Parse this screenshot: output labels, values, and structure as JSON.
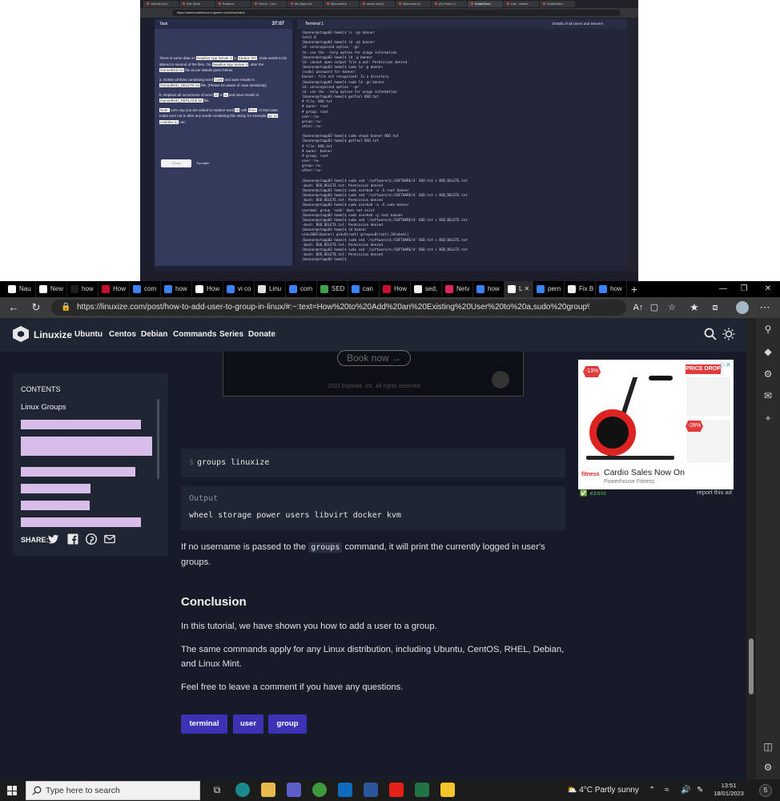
{
  "remote": {
    "tabs": [
      "Ubuntu Linu",
      "Our Work",
      "Examco",
      "Home - Cho",
      "My Apps Da",
      "Microsoft A",
      "azure cloud",
      "Microsoft Co",
      "(2) Feed | Li",
      "KodeKloud",
      "Lab - Author",
      "KodeKloud"
    ],
    "url": "https://www.kodekloud-engineer.com/#/scenario",
    "task_label": "Task",
    "timer": "37:07",
    "task_paragraphs": [
      {
        "parts": [
          {
            "t": "There is some data on "
          },
          {
            "c": "Nautilus App Server 3"
          },
          {
            "t": " in "
          },
          {
            "c": "Stratos"
          },
          {
            "c": "DC"
          },
          {
            "t": ". Data needs to be altered in several of the files. On "
          },
          {
            "c": "Nautilus App Server 3"
          },
          {
            "t": ", alter the "
          },
          {
            "c": "/home/BSD.txt"
          },
          {
            "t": " file as per details given below:"
          }
        ]
      },
      {
        "parts": [
          {
            "t": "a. Delete all lines containing word "
          },
          {
            "c": "code"
          },
          {
            "t": " and save results in "
          },
          {
            "c": "/home/BSD_DELETE.txt"
          },
          {
            "t": " file. (Please be aware of case sensitivity)"
          }
        ]
      },
      {
        "parts": [
          {
            "t": "b. Replace all occurrence of word "
          },
          {
            "c": "or"
          },
          {
            "t": " to "
          },
          {
            "c": "is"
          },
          {
            "t": " and save results in "
          },
          {
            "c": "/home/BSD_REPLACE.txt"
          },
          {
            "t": " file."
          }
        ]
      },
      {
        "parts": [
          {
            "c": "Note:"
          },
          {
            "t": " Let's say you are asked to replace word "
          },
          {
            "c": "to"
          },
          {
            "t": " with "
          },
          {
            "c": "from"
          },
          {
            "t": ". In that case, make sure not to alter any words containing this string; for example "
          },
          {
            "c": "up"
          },
          {
            "c": "to"
          },
          {
            "t": ", "
          },
          {
            "c": "contribu"
          },
          {
            "c": "to"
          },
          {
            "t": "r etc."
          }
        ]
      }
    ],
    "check_label": "Check",
    "try_later_label": "Try Later",
    "terminal_title": "Terminal 1",
    "terminal_right": "Details of all Users and Servers",
    "terminal_lines": [
      "[banner@stapp03 home]$ ls -gn banner",
      "total 0",
      "[banner@stapp03 home]$ ld -gn banner",
      "ld: unrecognized option '-gn'",
      "ld: use the --help option for usage information",
      "[banner@stapp03 home]$ ld -g banner",
      "ld: cannot open output file a.out: Permission denied",
      "[banner@stapp03 home]$ sudo ld -g banner",
      "[sudo] password for banner:",
      "banner: file not recognized: Is a directory",
      "[banner@stapp03 home]$ sudo ld -gn banner",
      "ld: unrecognized option '-gn'",
      "ld: use the --help option for usage information",
      "[banner@stapp03 home]$ getfacl BSD.txt",
      "# file: BSD.txt",
      "# owner: root",
      "# group: root",
      "user::rw-",
      "group::rw-",
      "other::rw-",
      "",
      "[banner@stapp03 home]$ sudo chown banner BSD.txt",
      "[banner@stapp03 home]$ getfacl BSD.txt",
      "# file: BSD.txt",
      "# owner: banner",
      "# group: root",
      "user::rw-",
      "group::rw-",
      "other::rw-",
      "",
      "[banner@stapp03 home]$ sudo sed '/software/d;/SOFTWARE/d' BSD.txt > BSD_DELETE.txt",
      "-bash: BSD_DELETE.txt: Permission denied",
      "[banner@stapp03 home]$ sudo usermod -a -G root banner",
      "[banner@stapp03 home]$ sudo sed '/software/d;/SOFTWARE/d' BSD.txt > BSD_DELETE.txt",
      "-bash: BSD_DELETE.txt: Permission denied",
      "[banner@stapp03 home]$ sudo usermod -a -G sudo banner",
      "usermod: group 'sudo' does not exist",
      "[banner@stapp03 home]$ sudo usermod -g root banner",
      "[banner@stapp03 home]$ sudo sed '/software/d;/SOFTWARE/d' BSD.txt > BSD_DELETE.txt",
      "-bash: BSD_DELETE.txt: Permission denied",
      "[banner@stapp03 home]$ id banner",
      "uid=1002(banner) gid=0(root) groups=0(root),10(wheel)",
      "[banner@stapp03 home]$ sudo sed '/software/d;/SOFTWARE/d' BSD.txt > BSD_DELETE.txt",
      "-bash: BSD_DELETE.txt: Permission denied",
      "[banner@stapp03 home]$ sudo sed '/software/d;/SOFTWARE/d' BSD.txt > BSD_DELETE.txt",
      "-bash: BSD_DELETE.txt: Permission denied",
      "[banner@stapp03 home]$ "
    ]
  },
  "browser": {
    "tabs": [
      {
        "label": "Nau",
        "icon": "#ffffff"
      },
      {
        "label": "New",
        "icon": "#ffffff"
      },
      {
        "label": "how",
        "icon": "#1e1e1e"
      },
      {
        "label": "How",
        "icon": "#c8102e"
      },
      {
        "label": "com",
        "icon": "#3b82f6"
      },
      {
        "label": "how",
        "icon": "#3b82f6"
      },
      {
        "label": "How",
        "icon": "#ffffff"
      },
      {
        "label": "vi co",
        "icon": "#3b82f6"
      },
      {
        "label": "Linu",
        "icon": "#e0e0e0"
      },
      {
        "label": "com",
        "icon": "#3b82f6"
      },
      {
        "label": "SED",
        "icon": "#3fa34d"
      },
      {
        "label": "can",
        "icon": "#3b82f6"
      },
      {
        "label": "How",
        "icon": "#c8102e"
      },
      {
        "label": "sed,",
        "icon": "#f0f0f0"
      },
      {
        "label": "Netv",
        "icon": "#e0245e"
      },
      {
        "label": "how",
        "icon": "#3b82f6"
      },
      {
        "label": "L",
        "icon": "#ffffff"
      },
      {
        "label": "pern",
        "icon": "#3b82f6"
      },
      {
        "label": "Fix B",
        "icon": "#f0f0f0"
      },
      {
        "label": "how",
        "icon": "#3b82f6"
      }
    ],
    "active_tab_index": 16,
    "new_tab": "+",
    "url": "https://linuxize.com/post/how-to-add-user-to-group-in-linux/#:~:text=How%20to%20Add%20an%20Existing%20User%20to%20a,sudo%20group%2C%20you%2..."
  },
  "site": {
    "brand": "Linuxize",
    "nav": [
      "Ubuntu",
      "Centos",
      "Debian",
      "Commands",
      "Series",
      "Donate"
    ],
    "ad_top": {
      "button": "Book now →",
      "footer": "2022 Expedia, Inc. All rights reserved"
    },
    "toc": {
      "title": "CONTENTS",
      "group": "Linux Groups",
      "items": [
        "How to Add an Existing User to a Group",
        "How to Add an Existing User to Multiple Groups in One Command",
        "How to Remove a User From a Group",
        "How to Create a Group",
        "How to Delete a Group",
        "How to Change a User's Primary Group"
      ],
      "share_label": "SHARE:"
    },
    "code_prompt": "$",
    "code_command": "groups linuxize",
    "output_label": "Output",
    "output_text": "wheel storage power users libvirt docker kvm",
    "para1_before": "If no username is passed to the ",
    "para1_code": "groups",
    "para1_after": " command, it will print the currently logged in user's groups.",
    "conclusion_heading": "Conclusion",
    "conclusion_p1": "In this tutorial, we have shown you how to add a user to a group.",
    "conclusion_p2": "The same commands apply for any Linux distribution, including Ubuntu, CentOS, RHEL, Debian, and Linux Mint.",
    "conclusion_p3": "Feel free to leave a comment if you have any questions.",
    "tags": [
      "terminal",
      "user",
      "group"
    ],
    "ad_side": {
      "badge1": "-13%",
      "badge2": "-28%",
      "price_drop": "PRICE DROP",
      "brand_logo": "fitness",
      "headline": "Cardio Sales Now On",
      "advertiser": "Powerhouse Fitness",
      "ezoic": "ezoic",
      "report": "report this ad"
    }
  },
  "taskbar": {
    "search_placeholder": "Type here to search",
    "weather": "4°C  Partly sunny",
    "time": "13:51",
    "date": "18/01/2023",
    "notifications": "5"
  },
  "colors": {
    "page_bg": "#161b27",
    "nav_bg": "#1f2532",
    "tag_bg": "#3b32b6",
    "toc_highlight": "#d8bde8"
  }
}
